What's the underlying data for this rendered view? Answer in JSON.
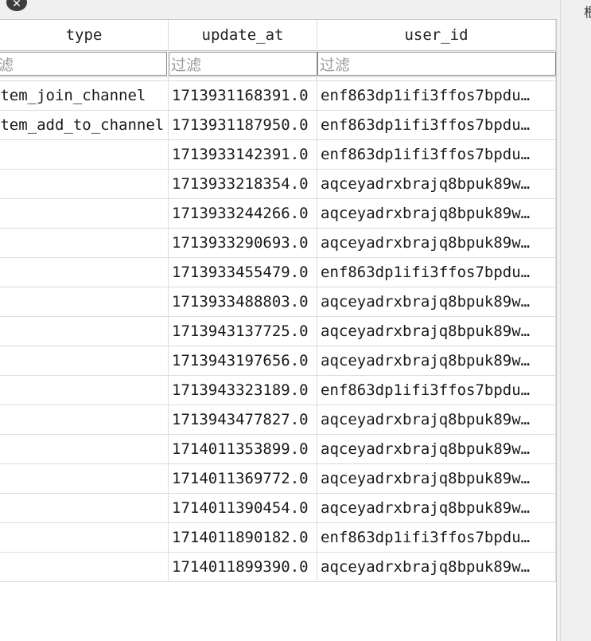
{
  "window": {
    "close_icon": "close-icon",
    "right_panel_glyph": "根"
  },
  "columns": {
    "type": "type",
    "update_at": "update_at",
    "user_id": "user_id"
  },
  "filter": {
    "placeholder": "过滤",
    "type_placeholder_fragment": "滤"
  },
  "rows": [
    {
      "type": "system_join_channel",
      "update_at": "1713931168391.0",
      "user_id": "enf863dp1ifi3ffos7bpdu…"
    },
    {
      "type": "system_add_to_channel",
      "update_at": "1713931187950.0",
      "user_id": "enf863dp1ifi3ffos7bpdu…"
    },
    {
      "type": "",
      "update_at": "1713933142391.0",
      "user_id": "enf863dp1ifi3ffos7bpdu…"
    },
    {
      "type": "",
      "update_at": "1713933218354.0",
      "user_id": "aqceyadrxbrajq8bpuk89w…"
    },
    {
      "type": "",
      "update_at": "1713933244266.0",
      "user_id": "aqceyadrxbrajq8bpuk89w…"
    },
    {
      "type": "",
      "update_at": "1713933290693.0",
      "user_id": "aqceyadrxbrajq8bpuk89w…"
    },
    {
      "type": "",
      "update_at": "1713933455479.0",
      "user_id": "enf863dp1ifi3ffos7bpdu…"
    },
    {
      "type": "",
      "update_at": "1713933488803.0",
      "user_id": "aqceyadrxbrajq8bpuk89w…"
    },
    {
      "type": "",
      "update_at": "1713943137725.0",
      "user_id": "aqceyadrxbrajq8bpuk89w…"
    },
    {
      "type": "",
      "update_at": "1713943197656.0",
      "user_id": "aqceyadrxbrajq8bpuk89w…"
    },
    {
      "type": "",
      "update_at": "1713943323189.0",
      "user_id": "enf863dp1ifi3ffos7bpdu…"
    },
    {
      "type": "",
      "update_at": "1713943477827.0",
      "user_id": "aqceyadrxbrajq8bpuk89w…"
    },
    {
      "type": "",
      "update_at": "1714011353899.0",
      "user_id": "aqceyadrxbrajq8bpuk89w…"
    },
    {
      "type": "",
      "update_at": "1714011369772.0",
      "user_id": "aqceyadrxbrajq8bpuk89w…"
    },
    {
      "type": "",
      "update_at": "1714011390454.0",
      "user_id": "aqceyadrxbrajq8bpuk89w…"
    },
    {
      "type": "",
      "update_at": "1714011890182.0",
      "user_id": "enf863dp1ifi3ffos7bpdu…"
    },
    {
      "type": "",
      "update_at": "1714011899390.0",
      "user_id": "aqceyadrxbrajq8bpuk89w…"
    }
  ]
}
